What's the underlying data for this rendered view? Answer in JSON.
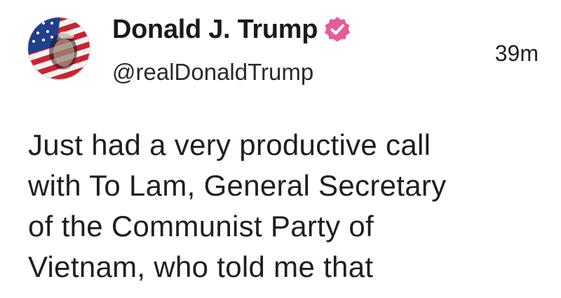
{
  "post": {
    "author": {
      "display_name": "Donald J. Trump",
      "handle": "@realDonaldTrump",
      "verified": true,
      "verified_badge_color": "#e45b9b",
      "avatar_icon": "profile-avatar-flag-portrait"
    },
    "timestamp": "39m",
    "body_lines": [
      "Just had a very productive call",
      "with To Lam, General Secretary",
      "of the Communist Party of",
      "Vietnam, who told me that"
    ]
  }
}
